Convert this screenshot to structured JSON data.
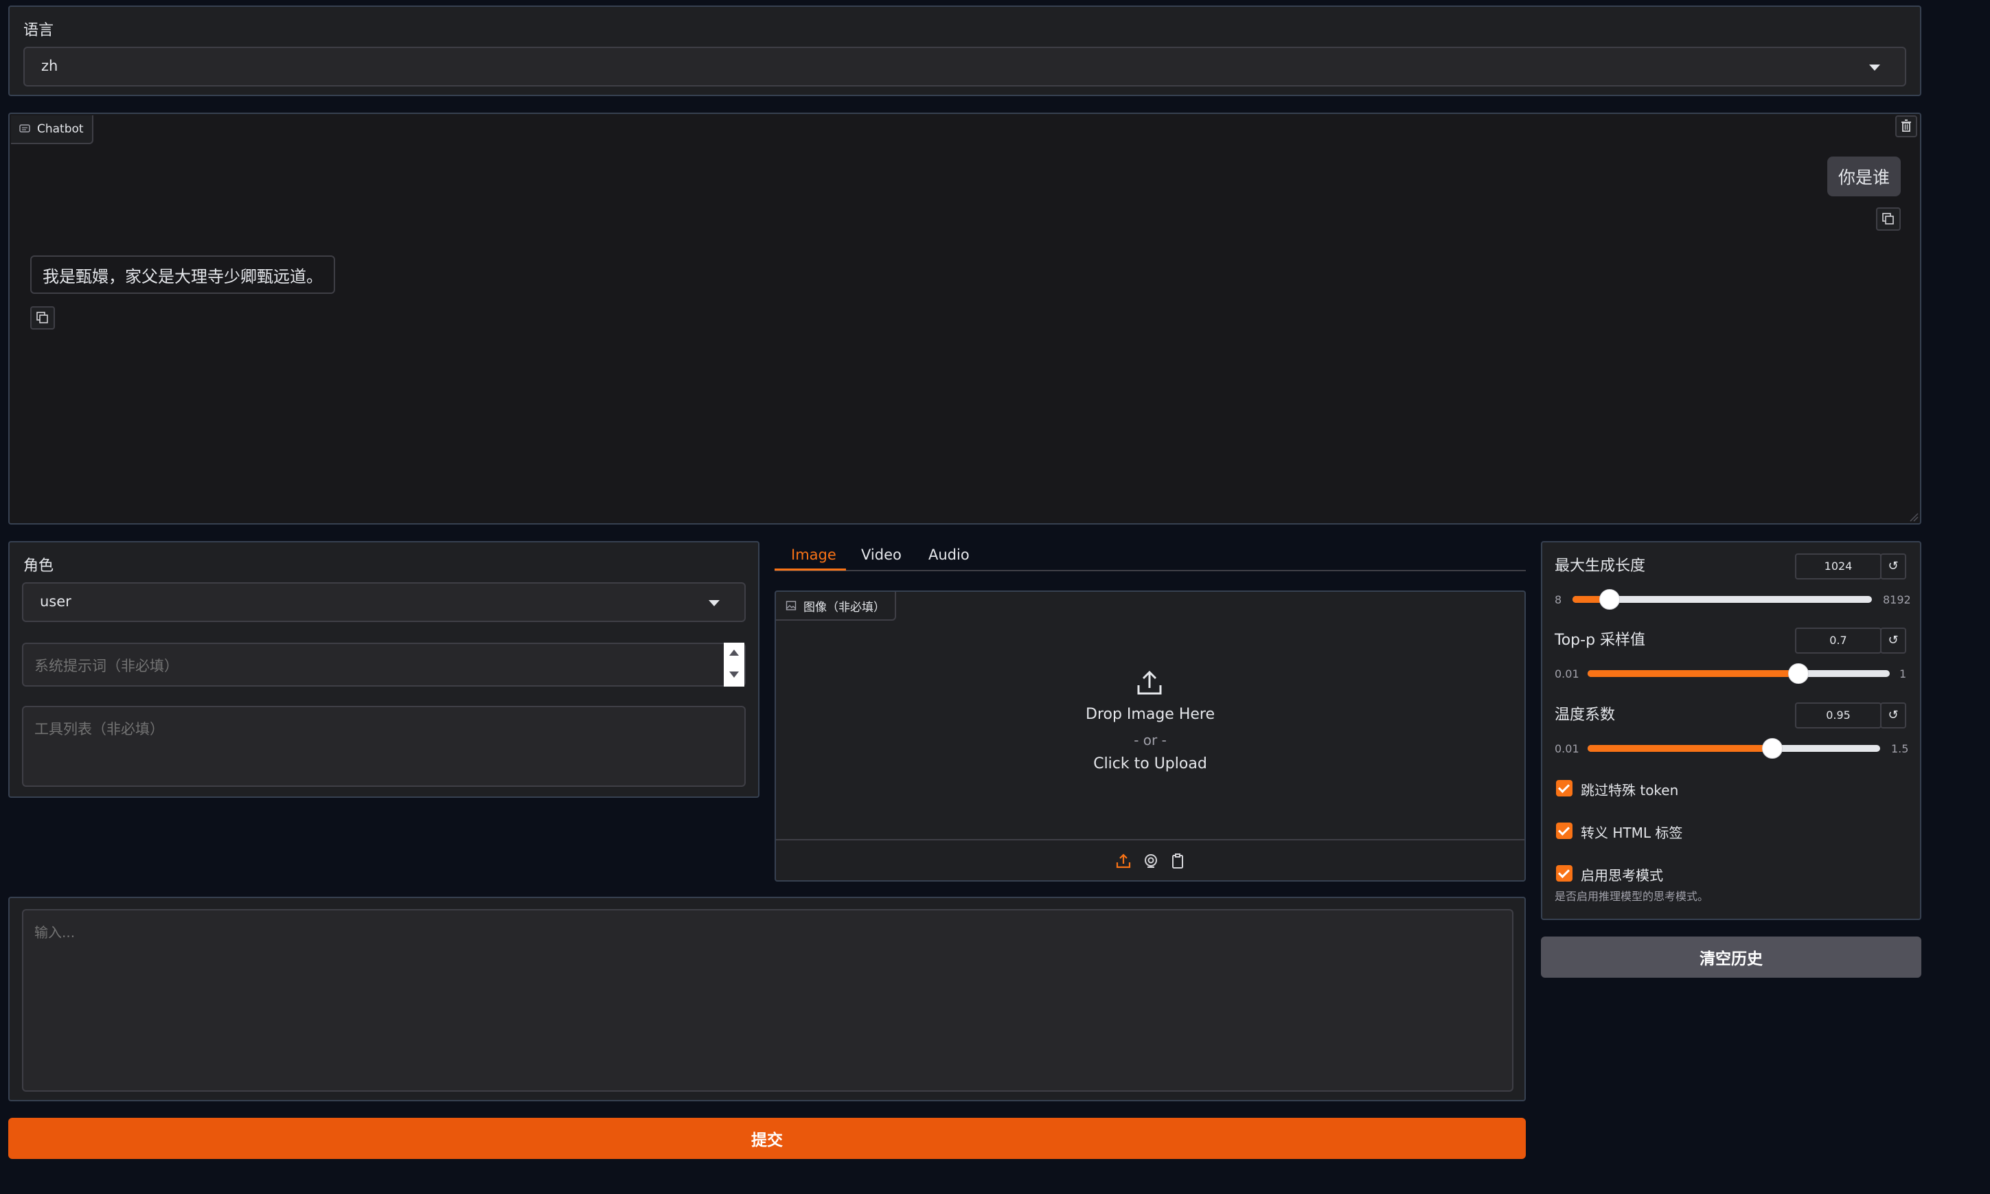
{
  "language": {
    "label": "语言",
    "value": "zh"
  },
  "chatbot": {
    "label": "Chatbot",
    "user_message": "你是谁",
    "bot_message": "我是甄嬛，家父是大理寺少卿甄远道。"
  },
  "role": {
    "label": "角色",
    "value": "user"
  },
  "system_prompt": {
    "placeholder": "系统提示词（非必填）"
  },
  "tools": {
    "placeholder": "工具列表（非必填）"
  },
  "media_tabs": [
    "Image",
    "Video",
    "Audio"
  ],
  "image_upload": {
    "label": "图像（非必填）",
    "drop_text": "Drop Image Here",
    "or_text": "- or -",
    "click_text": "Click to Upload"
  },
  "input": {
    "placeholder": "输入..."
  },
  "submit_label": "提交",
  "settings": {
    "max_length": {
      "label": "最大生成长度",
      "value": "1024",
      "min": "8",
      "max": "8192",
      "fraction": 0.124
    },
    "top_p": {
      "label": "Top-p 采样值",
      "value": "0.7",
      "min": "0.01",
      "max": "1",
      "fraction": 0.697
    },
    "temperature": {
      "label": "温度系数",
      "value": "0.95",
      "min": "0.01",
      "max": "1.5",
      "fraction": 0.631
    },
    "skip_special": {
      "label": "跳过特殊 token",
      "checked": true
    },
    "escape_html": {
      "label": "转义 HTML 标签",
      "checked": true
    },
    "thinking": {
      "label": "启用思考模式",
      "info": "是否启用推理模型的思考模式。",
      "checked": true
    },
    "reset_glyph": "↺"
  },
  "clear_label": "清空历史",
  "colors": {
    "accent": "#f97316",
    "submit": "#ea580c",
    "panel": "#1f2023"
  }
}
